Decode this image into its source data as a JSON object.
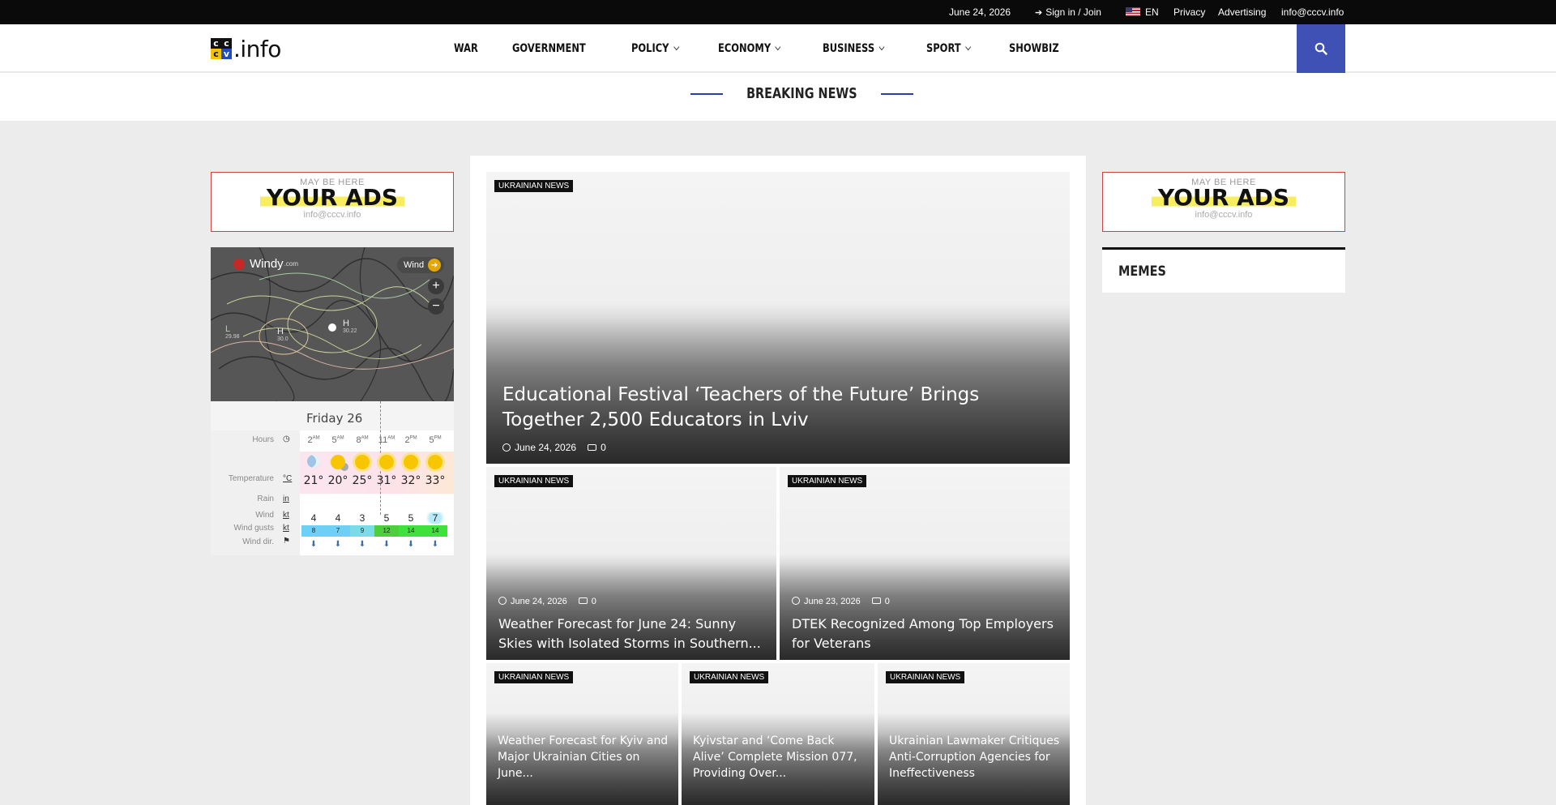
{
  "topbar": {
    "date": "June 24, 2026",
    "signin": "Sign in / Join",
    "lang": "EN",
    "privacy": "Privacy",
    "advertising": "Advertising",
    "email": "info@cccv.info"
  },
  "logo": {
    "box": [
      "c",
      "c",
      "c",
      "v"
    ],
    "text": ".info"
  },
  "nav": [
    {
      "label": "WAR",
      "dropdown": false
    },
    {
      "label": "GOVERNMENT",
      "dropdown": false
    },
    {
      "label": "POLICY",
      "dropdown": true
    },
    {
      "label": "ECONOMY",
      "dropdown": true
    },
    {
      "label": "BUSINESS",
      "dropdown": true
    },
    {
      "label": "SPORT",
      "dropdown": true
    },
    {
      "label": "SHOWBIZ",
      "dropdown": false
    }
  ],
  "breaking": {
    "title": "BREAKING NEWS"
  },
  "ad": {
    "top": "MAY BE HERE",
    "main": "YOUR ADS",
    "email": "info@cccv.info"
  },
  "windy": {
    "brand": "Windy",
    "brand_suffix": ".com",
    "layer": "Wind",
    "zoom_in": "+",
    "zoom_out": "−",
    "pressures": [
      {
        "letter": "L",
        "value": "29.98"
      },
      {
        "letter": "H",
        "value": "30.0"
      },
      {
        "letter": "H",
        "value": "30.22"
      }
    ],
    "day": "Friday 26",
    "labels": {
      "hours": "Hours",
      "temperature": "Temperature",
      "rain": "Rain",
      "wind": "Wind",
      "gusts": "Wind gusts",
      "dir": "Wind dir."
    },
    "units": {
      "temp": "°C",
      "rain": "in",
      "wind": "kt",
      "gusts": "kt"
    },
    "hours": [
      {
        "h": "2",
        "ap": "AM"
      },
      {
        "h": "5",
        "ap": "AM"
      },
      {
        "h": "8",
        "ap": "AM"
      },
      {
        "h": "11",
        "ap": "AM"
      },
      {
        "h": "2",
        "ap": "PM"
      },
      {
        "h": "5",
        "ap": "PM"
      }
    ],
    "icons": [
      "moon",
      "sun-cloud",
      "sun",
      "sun",
      "sun",
      "sun"
    ],
    "temps": [
      "21°",
      "20°",
      "25°",
      "31°",
      "32°",
      "33°"
    ],
    "wind": [
      "4",
      "4",
      "3",
      "5",
      "5",
      "7"
    ],
    "gusts": [
      "8",
      "7",
      "9",
      "12",
      "14",
      "14"
    ],
    "gust_colors": [
      "#6fd0f5",
      "#6fd0f5",
      "#7adce6",
      "#4ccf3a",
      "#3ee23a",
      "#3ee23a"
    ]
  },
  "memes": {
    "title": "MEMES"
  },
  "featured": {
    "tag": "UKRAINIAN NEWS",
    "title": "Educational Festival ‘Teachers of the Future’ Brings Together 2,500 Educators in Lviv",
    "date": "June 24, 2026",
    "comments": "0"
  },
  "row2": [
    {
      "tag": "UKRAINIAN NEWS",
      "date": "June 24, 2026",
      "comments": "0",
      "title": "Weather Forecast for June 24: Sunny Skies with Isolated Storms in Southern..."
    },
    {
      "tag": "UKRAINIAN NEWS",
      "date": "June 23, 2026",
      "comments": "0",
      "title": "DTEK Recognized Among Top Employers for Veterans"
    }
  ],
  "row3": [
    {
      "tag": "UKRAINIAN NEWS",
      "title": "Weather Forecast for Kyiv and Major Ukrainian Cities on June..."
    },
    {
      "tag": "UKRAINIAN NEWS",
      "title": "Kyivstar and ‘Come Back Alive’ Complete Mission 077, Providing Over..."
    },
    {
      "tag": "UKRAINIAN NEWS",
      "title": "Ukrainian Lawmaker Critiques Anti-Corruption Agencies for Ineffectiveness"
    }
  ]
}
